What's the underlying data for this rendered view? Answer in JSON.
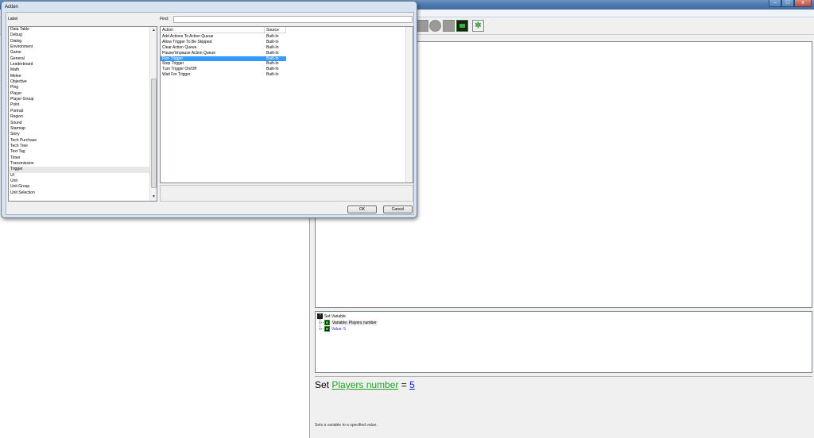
{
  "dialog": {
    "title": "Action",
    "label_header": "Label",
    "find_label": "Find:",
    "find_value": "",
    "labels": [
      "Data Table",
      "Debug",
      "Dialog",
      "Environment",
      "Game",
      "General",
      "Leaderboard",
      "Math",
      "Melee",
      "Objective",
      "Ping",
      "Player",
      "Player Group",
      "Point",
      "Portrait",
      "Region",
      "Sound",
      "Starmap",
      "Story",
      "Tech Purchase",
      "Tech Tree",
      "Text Tag",
      "Timer",
      "Transmission",
      "Trigger",
      "UI",
      "Unit",
      "Unit Group",
      "Unit Selection"
    ],
    "selected_label": "Trigger",
    "columns": {
      "action": "Action",
      "source": "Source"
    },
    "actions": [
      {
        "name": "Add Actions To Action Queue",
        "source": "Built-In"
      },
      {
        "name": "Allow Trigger To Be Skipped",
        "source": "Built-In"
      },
      {
        "name": "Clear Action Queue",
        "source": "Built-In"
      },
      {
        "name": "Pause/Unpause Action Queue",
        "source": "Built-In"
      },
      {
        "name": "Run Trigger",
        "source": "Built-In"
      },
      {
        "name": "Stop Trigger",
        "source": "Built-In"
      },
      {
        "name": "Turn Trigger On/Off",
        "source": "Built-In"
      },
      {
        "name": "Wait For Trigger",
        "source": "Built-In"
      }
    ],
    "selected_action": "Run Trigger",
    "ok_label": "OK",
    "cancel_label": "Cancel"
  },
  "window": {
    "minimize_glyph": "–",
    "maximize_glyph": "□",
    "close_glyph": "x"
  },
  "tree": {
    "root": "Set Variable",
    "variable": "Variable: Players number",
    "value": "Value: 5"
  },
  "sentence": {
    "prefix": "Set",
    "variable": "Players number",
    "equals": "=",
    "value": "5",
    "description": "Sets a variable to a specified value."
  },
  "icons": {
    "root_icon": "question-icon",
    "param_icon": "parameter-icon",
    "dna_icon": "dna-icon"
  },
  "colors": {
    "selection": "#3399ff",
    "variable_green": "#1fa21f",
    "value_blue": "#1a1ae0",
    "title_blue": "#4a77ad"
  }
}
